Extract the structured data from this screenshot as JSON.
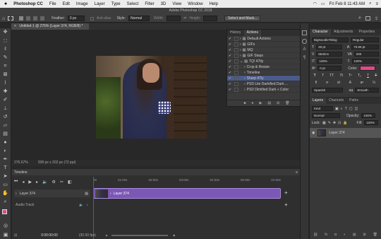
{
  "menubar": {
    "apple": "",
    "app_name": "Photoshop CC",
    "items": [
      "File",
      "Edit",
      "Image",
      "Layer",
      "Type",
      "Select",
      "Filter",
      "3D",
      "View",
      "Window",
      "Help"
    ],
    "clock": "Fri Feb 8  11:43 AM"
  },
  "window_title": "Adobe Photoshop CC 2019",
  "options": {
    "feather_label": "Feather:",
    "feather_value": "0 px",
    "antialias_label": "Anti-alias",
    "style_label": "Style:",
    "style_value": "Normal",
    "width_label": "Width:",
    "height_label": "Height:",
    "select_mask_button": "Select and Mask..."
  },
  "document": {
    "tab_label": "Untitled-1 @ 276% (Layer 374, RGB/8) *",
    "zoom": "276.67%",
    "doc_info": "208 px x 202 px (72 ppi)"
  },
  "actions_panel": {
    "tabs": [
      "History",
      "Actions"
    ],
    "active_tab": "Actions",
    "items": [
      {
        "label": "Default Actions",
        "type": "folder"
      },
      {
        "label": "GIFs",
        "type": "folder"
      },
      {
        "label": "MQ",
        "type": "folder"
      },
      {
        "label": "GIF Steps",
        "type": "folder"
      },
      {
        "label": "TQ! 47tly",
        "type": "folder"
      },
      {
        "label": "Crop & Resize",
        "type": "action"
      },
      {
        "label": "Timeline",
        "type": "action"
      },
      {
        "label": "Sharp 47ly",
        "type": "action",
        "selected": true
      },
      {
        "label": "PSD Lite Darkified Dark ...",
        "type": "action"
      },
      {
        "label": "PSD Dimified Dark + Color",
        "type": "action"
      }
    ]
  },
  "character_panel": {
    "tabs": [
      "Character",
      "Adjustments",
      "Properties"
    ],
    "font": "BigNoodleTitling",
    "style": "Regular",
    "size": "26 pt",
    "leading": "70.65 pt",
    "kerning": "Metrics",
    "tracking": "200",
    "vscale": "100%",
    "hscale": "100%",
    "baseline": "0 pt",
    "color_label": "Color:",
    "color": "#e2478c",
    "language": "Spanish",
    "aa": "Smooth"
  },
  "layers_panel": {
    "tabs": [
      "Layers",
      "Channels",
      "Paths"
    ],
    "filter": "Kind",
    "blend": "Normal",
    "opacity_label": "Opacity:",
    "opacity": "100%",
    "lock_label": "Lock:",
    "fill_label": "Fill:",
    "fill": "100%",
    "layer_name": "Layer 374"
  },
  "timeline": {
    "title": "Timeline",
    "ticks": [
      "00",
      "01:00s",
      "02:00s",
      "03:00s",
      "04:00s",
      "05:00s",
      "01:00s"
    ],
    "track_name": "Layer 374",
    "clip_label": "Layer 374",
    "audio_label": "Audio Track",
    "timecode": "0:00:00:00",
    "fps": "(30.00 fps)"
  }
}
